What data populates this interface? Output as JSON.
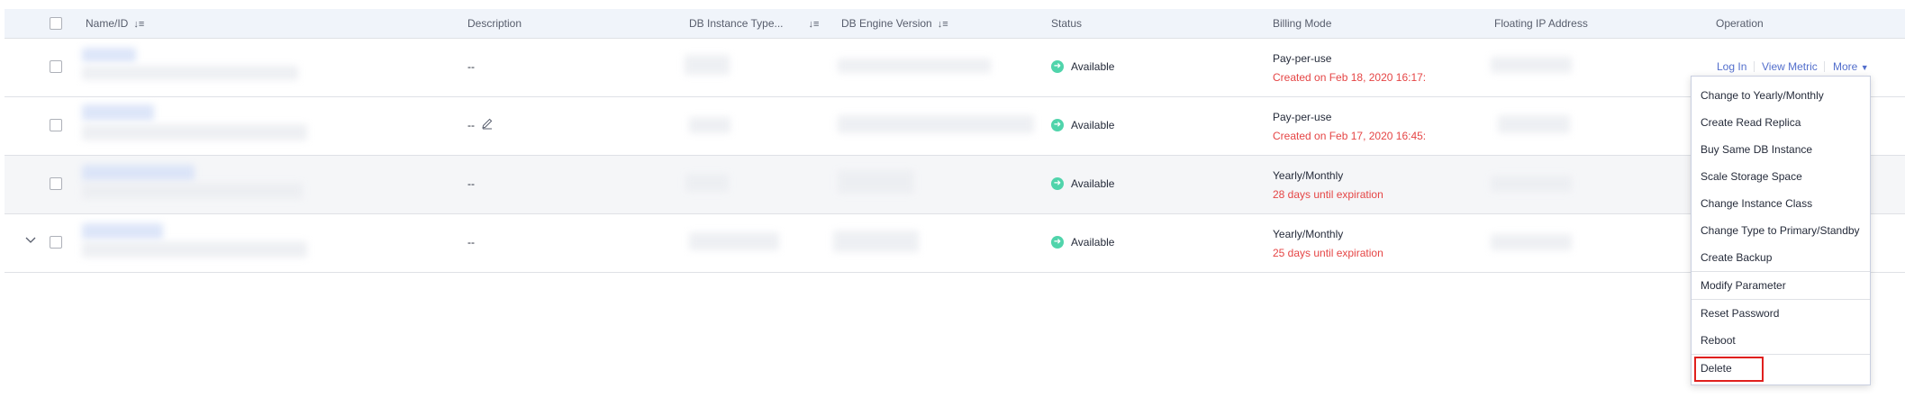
{
  "table": {
    "columns": {
      "name_id": "Name/ID",
      "description": "Description",
      "db_instance_type": "DB Instance Type...",
      "db_engine_version": "DB Engine Version",
      "status": "Status",
      "billing_mode": "Billing Mode",
      "floating_ip": "Floating IP Address",
      "operation": "Operation"
    },
    "rows": [
      {
        "description": "--",
        "status": "Available",
        "billing_mode": "Pay-per-use",
        "billing_detail": "Created on Feb 18, 2020 16:17:"
      },
      {
        "description": "--",
        "status": "Available",
        "billing_mode": "Pay-per-use",
        "billing_detail": "Created on Feb 17, 2020 16:45:"
      },
      {
        "description": "--",
        "status": "Available",
        "billing_mode": "Yearly/Monthly",
        "billing_detail": "28 days until expiration"
      },
      {
        "description": "--",
        "status": "Available",
        "billing_mode": "Yearly/Monthly",
        "billing_detail": "25 days until expiration"
      }
    ],
    "operations": {
      "log_in": "Log In",
      "view_metric": "View Metric",
      "more": "More"
    }
  },
  "more_menu": {
    "items": [
      "Change to Yearly/Monthly",
      "Create Read Replica",
      "Buy Same DB Instance",
      "Scale Storage Space",
      "Change Instance Class",
      "Change Type to Primary/Standby",
      "Create Backup",
      "Modify Parameter",
      "Reset Password",
      "Reboot",
      "Delete"
    ],
    "highlighted_item": "Delete"
  },
  "colors": {
    "link": "#526ecc",
    "warning_text": "#e54545",
    "status_available": "#50d4ab",
    "highlight_border": "#e0201e"
  }
}
